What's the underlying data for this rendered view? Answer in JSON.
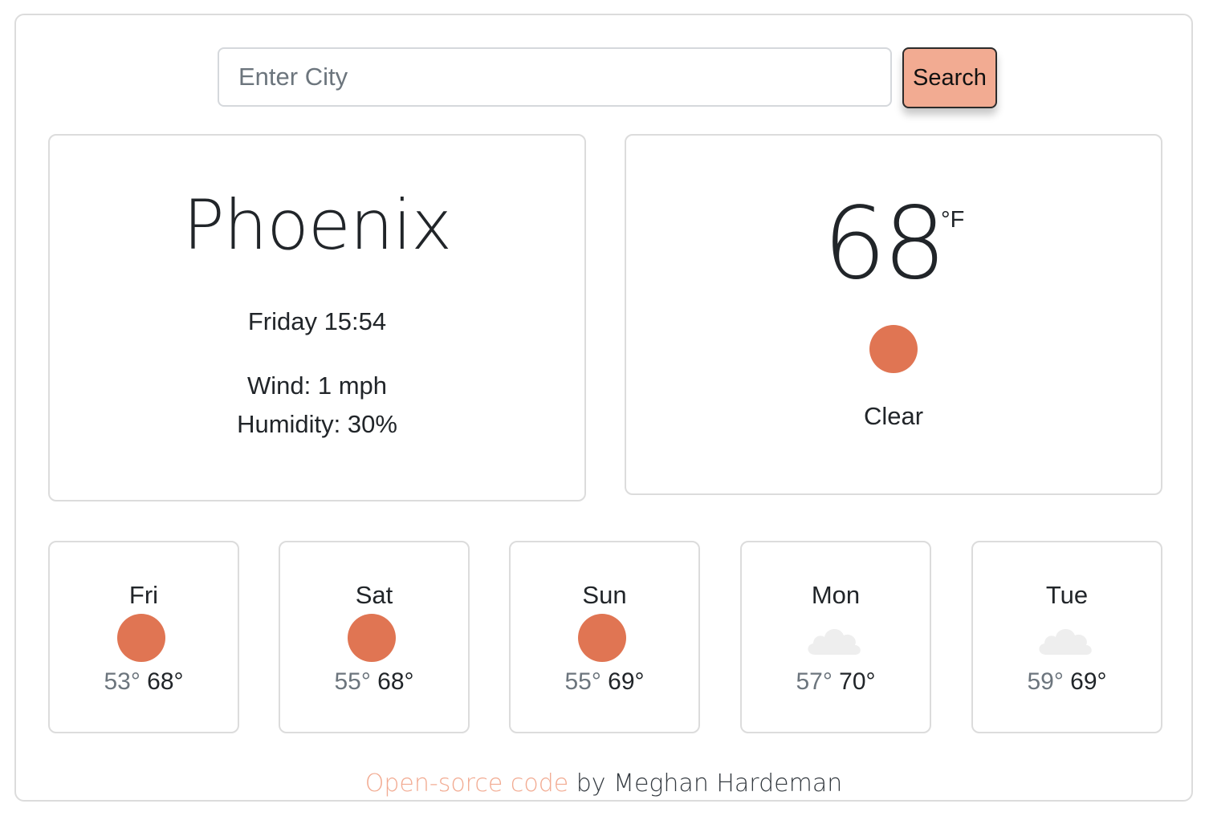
{
  "search": {
    "placeholder": "Enter City",
    "value": "",
    "button_label": "Search"
  },
  "current": {
    "city": "Phoenix",
    "datetime": "Friday 15:54",
    "wind": "Wind: 1 mph",
    "humidity": "Humidity: 30%",
    "temperature": "68",
    "unit": "°F",
    "condition": "Clear",
    "icon": "sun-icon"
  },
  "forecast": [
    {
      "day": "Fri",
      "low": "53°",
      "high": "68°",
      "icon": "sun-icon"
    },
    {
      "day": "Sat",
      "low": "55°",
      "high": "68°",
      "icon": "sun-icon"
    },
    {
      "day": "Sun",
      "low": "55°",
      "high": "69°",
      "icon": "sun-icon"
    },
    {
      "day": "Mon",
      "low": "57°",
      "high": "70°",
      "icon": "cloud-icon"
    },
    {
      "day": "Tue",
      "low": "59°",
      "high": "69°",
      "icon": "cloud-icon"
    }
  ],
  "footer": {
    "link_text": "Open-sorce code",
    "author_text": " by Meghan Hardeman"
  },
  "colors": {
    "accent": "#f2ab92",
    "sun": "#e07553",
    "cloud": "#eeeeee",
    "border": "#dcdcdc"
  }
}
